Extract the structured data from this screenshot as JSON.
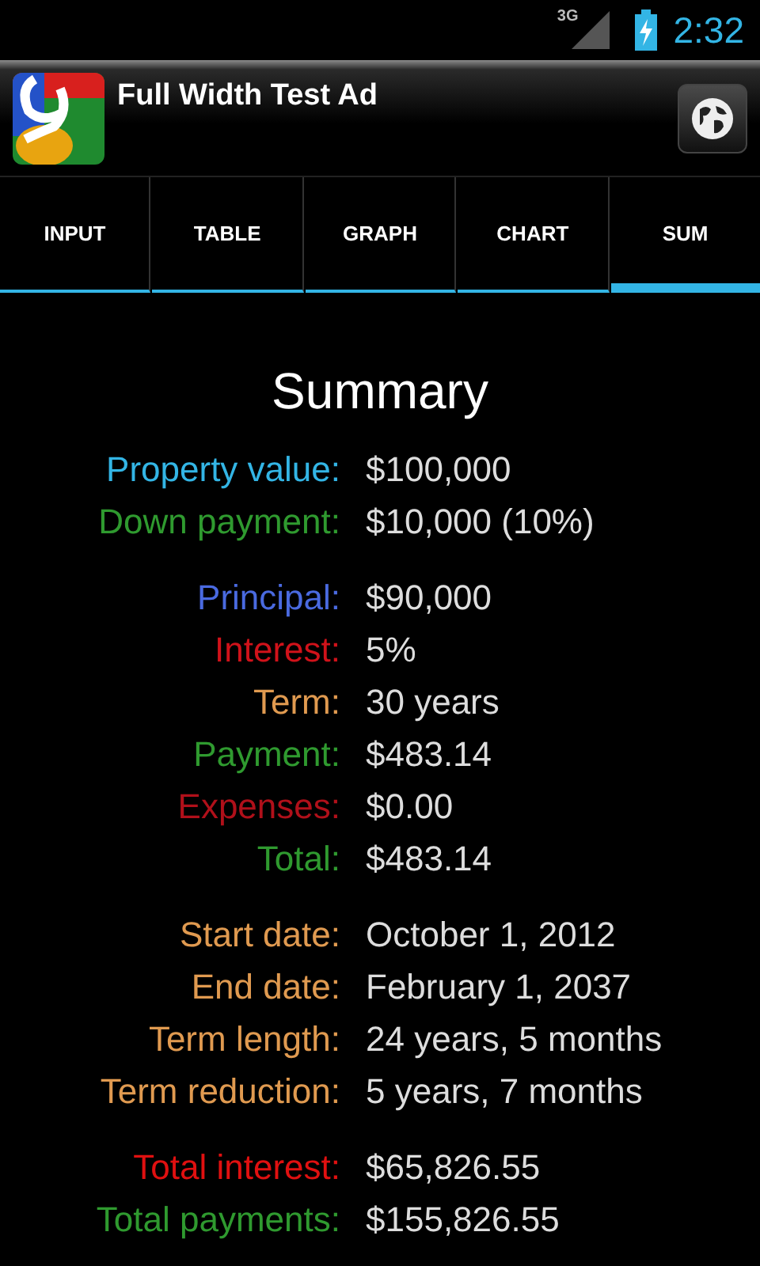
{
  "status_bar": {
    "network": "3G",
    "time": "2:32"
  },
  "ad_banner": {
    "title": "Full Width Test Ad"
  },
  "tabs": [
    {
      "label": "INPUT",
      "selected": false
    },
    {
      "label": "TABLE",
      "selected": false
    },
    {
      "label": "GRAPH",
      "selected": false
    },
    {
      "label": "CHART",
      "selected": false
    },
    {
      "label": "SUM",
      "selected": true
    }
  ],
  "summary": {
    "title": "Summary",
    "groups": [
      {
        "rows": [
          {
            "label": "Property value:",
            "value": "$100,000",
            "color": "#33b5e5"
          },
          {
            "label": "Down payment:",
            "value": "$10,000 (10%)",
            "color": "#2f9a2f"
          }
        ]
      },
      {
        "rows": [
          {
            "label": "Principal:",
            "value": "$90,000",
            "color": "#4a6ae0"
          },
          {
            "label": "Interest:",
            "value": "5%",
            "color": "#d0121a"
          },
          {
            "label": "Term:",
            "value": "30 years",
            "color": "#e09a50"
          },
          {
            "label": "Payment:",
            "value": "$483.14",
            "color": "#2f9a2f"
          },
          {
            "label": "Expenses:",
            "value": "$0.00",
            "color": "#b0101a"
          },
          {
            "label": "Total:",
            "value": "$483.14",
            "color": "#2f9a2f"
          }
        ]
      },
      {
        "rows": [
          {
            "label": "Start date:",
            "value": "October 1, 2012",
            "color": "#e09a50"
          },
          {
            "label": "End date:",
            "value": "February 1, 2037",
            "color": "#e09a50"
          },
          {
            "label": "Term length:",
            "value": "24 years, 5 months",
            "color": "#e09a50"
          },
          {
            "label": "Term reduction:",
            "value": "5 years, 7 months",
            "color": "#e09a50"
          }
        ]
      },
      {
        "rows": [
          {
            "label": "Total interest:",
            "value": "$65,826.55",
            "color": "#e01010"
          },
          {
            "label": "Total payments:",
            "value": "$155,826.55",
            "color": "#2f9a2f"
          }
        ]
      }
    ]
  }
}
